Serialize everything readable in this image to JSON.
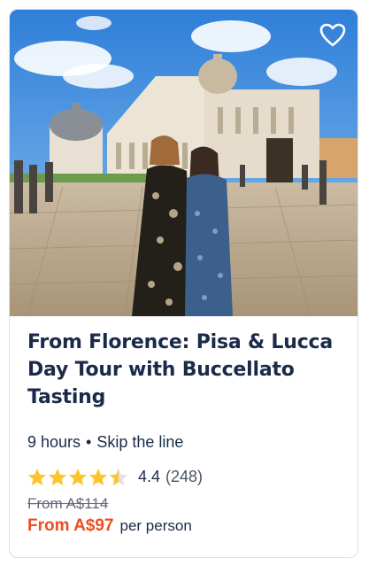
{
  "card": {
    "title": "From Florence: Pisa & Lucca Day Tour with Buccellato Tasting",
    "duration": "9 hours",
    "separator": "•",
    "feature": "Skip the line",
    "rating": {
      "value": "4.4",
      "count": "(248)",
      "stars_filled": 4.4,
      "star_color": "#fdc52b"
    },
    "old_price": "From A$114",
    "price": "From A$97",
    "per_person": "per person",
    "price_color": "#eb4e22",
    "wishlist_icon": "heart-outline-icon"
  }
}
